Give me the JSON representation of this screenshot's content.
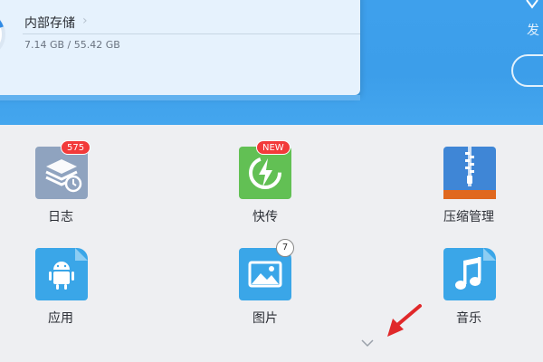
{
  "storage": {
    "title": "内部存储",
    "size_text": "7.14 GB / 55.42 GB",
    "used_fraction": 0.129
  },
  "header": {
    "right_text": "发"
  },
  "grid": [
    {
      "label": "日志",
      "icon": "log-stack-clock-icon",
      "badge": "575",
      "color": "#8fa3bf"
    },
    {
      "label": "快传",
      "icon": "lightning-sync-icon",
      "badge": "NEW",
      "color": "#62c054"
    },
    {
      "label": "压缩管理",
      "icon": "zip-archive-icon",
      "badge": "",
      "color": "#3f86d6"
    },
    {
      "label": "应用",
      "icon": "android-icon",
      "badge": "",
      "color": "#3aa6e8"
    },
    {
      "label": "图片",
      "icon": "image-icon",
      "badge": "7",
      "color": "#3aa6e8"
    },
    {
      "label": "音乐",
      "icon": "music-note-icon",
      "badge": "",
      "color": "#3aa6e8"
    }
  ],
  "colors": {
    "header_blue": "#3ea0ec",
    "badge_red": "#f23a3a",
    "page_bg": "#eeeff2"
  }
}
